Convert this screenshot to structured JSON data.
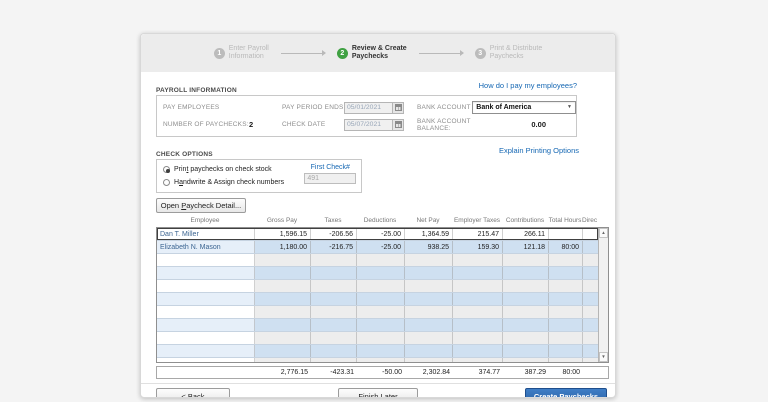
{
  "colors": {
    "accent_green": "#3fa142",
    "link_blue": "#1567b3",
    "primary_button_blue": "#2e6cb0",
    "row_highlight_blue": "#cfe0f1"
  },
  "stepper": {
    "steps": [
      {
        "number": "1",
        "line1": "Enter Payroll",
        "line2": "Information",
        "active": false
      },
      {
        "number": "2",
        "line1": "Review & Create",
        "line2": "Paychecks",
        "active": true
      },
      {
        "number": "3",
        "line1": "Print & Distribute",
        "line2": "Paychecks",
        "active": false
      }
    ]
  },
  "help_link": "How do I pay my employees?",
  "payroll_information": {
    "title": "PAYROLL INFORMATION",
    "pay_employees_label": "PAY EMPLOYEES",
    "number_of_paychecks_label": "NUMBER OF PAYCHECKS:",
    "number_of_paychecks_value": "2",
    "pay_period_ends_label": "PAY PERIOD ENDS",
    "pay_period_ends_value": "05/01/2021",
    "check_date_label": "CHECK DATE",
    "check_date_value": "05/07/2021",
    "bank_account_label": "BANK ACCOUNT",
    "bank_account_value": "Bank of America",
    "bank_balance_label": "BANK ACCOUNT BALANCE:",
    "bank_balance_value": "0.00"
  },
  "explain_link": "Explain Printing Options",
  "check_options": {
    "title": "CHECK OPTIONS",
    "print_option": {
      "pre": "Prin",
      "key": "t",
      "post": " paychecks on check stock"
    },
    "handwrite_option": {
      "pre": "H",
      "key": "a",
      "post": "ndwrite & Assign check numbers"
    },
    "selected_option": "print",
    "first_check_label": "First Check#",
    "first_check_value": "491"
  },
  "open_paycheck_detail": {
    "pre": "Open ",
    "key": "P",
    "post": "aycheck Detail..."
  },
  "table": {
    "columns": [
      "Employee",
      "Gross Pay",
      "Taxes",
      "Deductions",
      "Net Pay",
      "Employer Taxes",
      "Contributions",
      "Total Hours",
      "Direct Dep"
    ],
    "rows": [
      {
        "employee": "Dan T. Miller",
        "values": [
          "1,596.15",
          "-206.56",
          "-25.00",
          "1,364.59",
          "215.47",
          "266.11",
          "",
          ""
        ],
        "selected": true
      },
      {
        "employee": "Elizabeth N. Mason",
        "values": [
          "1,180.00",
          "-216.75",
          "-25.00",
          "938.25",
          "159.30",
          "121.18",
          "80:00",
          ""
        ],
        "selected": false
      }
    ],
    "empty_row_count": 9,
    "totals": [
      "2,776.15",
      "-423.31",
      "-50.00",
      "2,302.84",
      "374.77",
      "387.29",
      "80:00",
      ""
    ]
  },
  "scrollbar": {
    "up_glyph": "▲",
    "down_glyph": "▼"
  },
  "dropdown_caret": "▼",
  "footer": {
    "back_label": "< Back",
    "finish_later_label": "Finish Later",
    "create_label": "Create Paychecks"
  }
}
